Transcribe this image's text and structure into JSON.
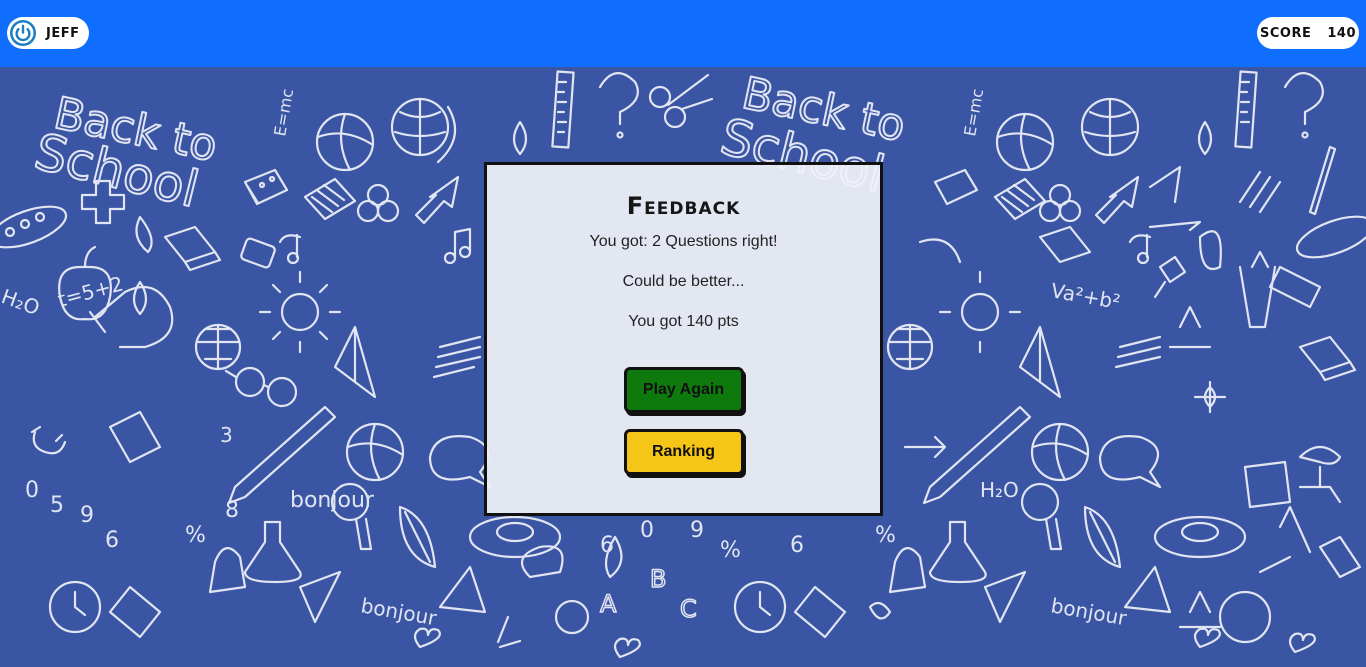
{
  "header": {
    "user_name": "Jeff",
    "score_label": "Score",
    "score_value": "140"
  },
  "background": {
    "doodle_texts": [
      "Back to",
      "School",
      "E=mc",
      "Va²+b²",
      "t=5+2",
      "H₂O",
      "bonjour",
      "0",
      "5",
      "9",
      "6",
      "%",
      "8",
      "3",
      "A",
      "B",
      "C"
    ]
  },
  "feedback": {
    "title": "Feedback",
    "questions_right": "You got: 2 Questions right!",
    "remark": "Could be better...",
    "points": "You got 140 pts",
    "play_again_label": "Play Again",
    "ranking_label": "Ranking"
  },
  "colors": {
    "topbar": "#0f6efd",
    "background": "#3a55a4",
    "play_again": "#0e7a0d",
    "ranking": "#f5c518"
  }
}
